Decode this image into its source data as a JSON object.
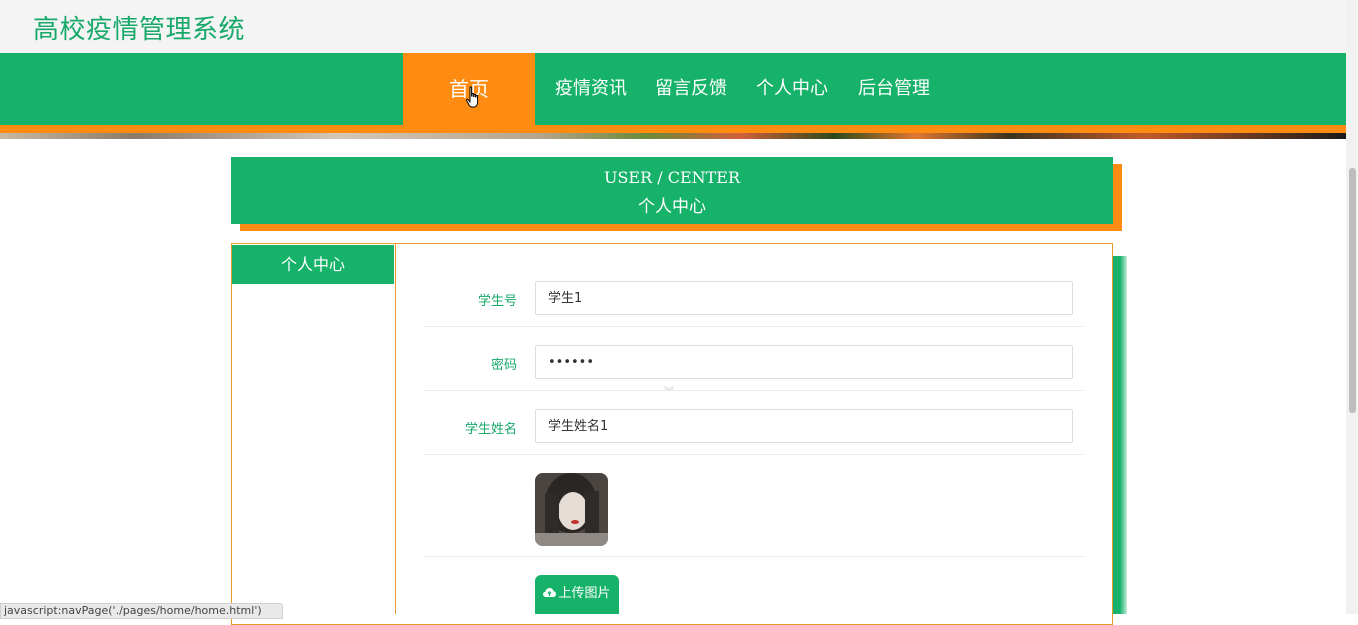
{
  "site": {
    "title": "高校疫情管理系统"
  },
  "nav": {
    "items": [
      {
        "label": "首页"
      },
      {
        "label": "疫情资讯"
      },
      {
        "label": "留言反馈"
      },
      {
        "label": "个人中心"
      },
      {
        "label": "后台管理"
      }
    ],
    "active_index": 0
  },
  "header": {
    "en": "USER / CENTER",
    "cn": "个人中心"
  },
  "sidebar": {
    "items": [
      {
        "label": "个人中心"
      }
    ]
  },
  "form": {
    "student_id": {
      "label": "学生号",
      "value": "学生1"
    },
    "password": {
      "label": "密码",
      "value": "••••••"
    },
    "student_name": {
      "label": "学生姓名",
      "value": "学生姓名1"
    },
    "upload_button": "上传图片"
  },
  "status_bar": {
    "text": "javascript:navPage('./pages/home/home.html')"
  },
  "colors": {
    "primary": "#17b26a",
    "accent": "#ff8c12"
  },
  "icons": {
    "upload": "cloud-upload-icon",
    "cursor": "hand-pointer-icon"
  }
}
